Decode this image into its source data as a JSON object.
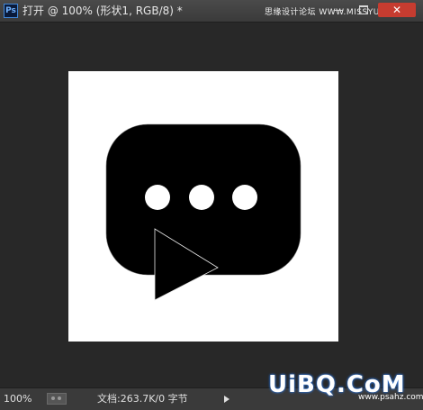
{
  "window": {
    "app_icon": "Ps",
    "title": "打开 @ 100% (形状1, RGB/8) *",
    "minimize": "—",
    "close": "✕"
  },
  "watermark": {
    "top_text": "思缘设计论坛 WWW.MISSYUAN.COM",
    "bottom_text": "UiBQ.CoM",
    "bottom_sub": "www.psahz.com"
  },
  "status": {
    "zoom": "100%",
    "doc_info": "文档:263.7K/0 字节"
  },
  "artwork": {
    "bubble_color": "#000000",
    "dot_color": "#ffffff",
    "canvas_color": "#ffffff",
    "icon": "chat-bubble-icon"
  }
}
